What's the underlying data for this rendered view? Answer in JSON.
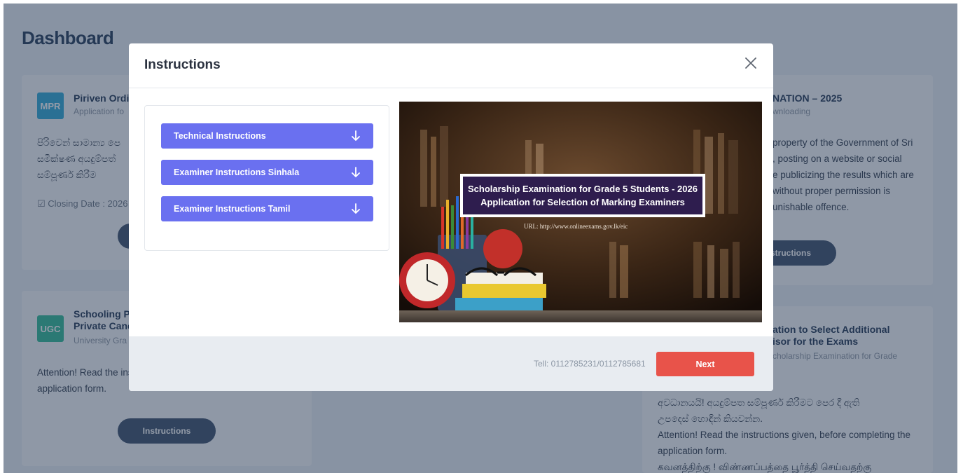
{
  "page": {
    "title": "Dashboard"
  },
  "cards": {
    "piriven": {
      "badge": "MPR",
      "badge_color": "#2da9d6",
      "title": "Piriven Ordi",
      "subtitle": "Application fo",
      "text_lines": [
        "පිරිවෙන් සාමාන්‍ය පෙ",
        "සමීක්ෂණ අයදුම්පත්‍",
        "සම්පූර්ණ කිරීම"
      ],
      "closing": "Closing Date : 2026"
    },
    "schooling": {
      "badge": "UGC",
      "badge_color": "#2fba96",
      "title_line1": "Schooling P",
      "title_line2": "Private Canc",
      "subtitle": "University Gra",
      "text_line1": "Attention! Read the ins",
      "text_line2": "application form.",
      "button": "Instructions"
    },
    "right_top": {
      "title": "NATION – 2025",
      "subtitle": "wnloading",
      "text_lines": [
        "property of the Government of Sri",
        ", posting on a website or social",
        "e publicizing the results which are",
        "without proper permission is",
        "unishable offence."
      ],
      "button": "structions"
    },
    "right_bottom": {
      "title_line1": "ation to Select Additional",
      "title_line2": "isor for the Exams",
      "subtitle": "cholarship Examination for Grade",
      "text_lines": [
        "අවධානයයි! අයදුම්පත සම්පූර්ණ කිරීමට පෙර දී ඇති",
        "උපදෙස් හොඳින් කියවන්න.",
        "Attention! Read the instructions given, before completing the",
        "application form.",
        "கவனத்திற்கு ! விண்ணப்பத்தை பூர்த்தி செய்வதற்கு"
      ]
    }
  },
  "modal": {
    "title": "Instructions",
    "accordion": [
      {
        "label": "Technical Instructions"
      },
      {
        "label": "Examiner Instructions Sinhala"
      },
      {
        "label": "Examiner Instructions Tamil"
      }
    ],
    "banner": {
      "line1": "Scholarship Examination for Grade 5 Students - 2026",
      "line2": "Application for Selection of Marking Examiners",
      "url": "URL:   http://www.onlineexams.gov.lk/eic"
    },
    "tell": "Tell: 0112785231/0112785681",
    "next_button": "Next"
  },
  "colors": {
    "accent": "#6a70f0",
    "next": "#e8534a",
    "pill": "#3b4f6b"
  }
}
